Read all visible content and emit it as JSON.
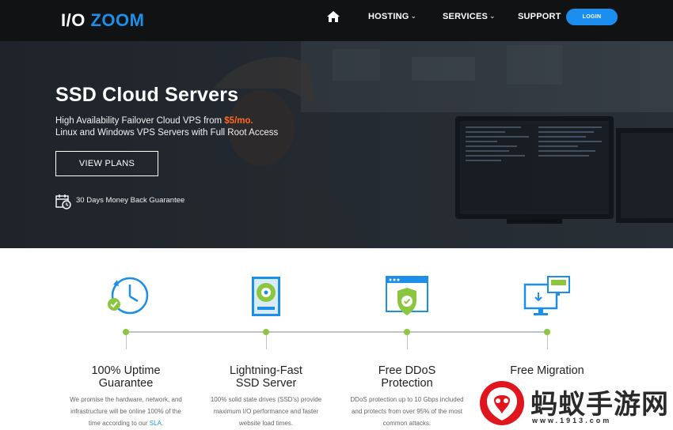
{
  "nav": {
    "logo_part1": "I/O",
    "logo_part2": "ZOOM",
    "home_icon": "home-icon",
    "hosting": "HOSTING",
    "services": "SERVICES",
    "support": "SUPPORT",
    "login": "LOGIN",
    "chevron": "⌄"
  },
  "hero": {
    "title": "SSD Cloud Servers",
    "line1_prefix": "High Availability Failover Cloud VPS from ",
    "price": "$5/mo.",
    "line2": "Linux and Windows VPS Servers with Full Root Access",
    "button": "VIEW PLANS",
    "guarantee": "30 Days Money Back Guarantee",
    "guarantee_icon": "calendar-clock-icon"
  },
  "features": [
    {
      "icon": "uptime-clock-icon",
      "title1": "100% Uptime",
      "title2": "Guarantee",
      "desc1": "We promise the hardware, network, and",
      "desc2": "infrastructure will be online 100% of the",
      "desc3_prefix": "time according to our ",
      "desc3_link": "SLA",
      "desc3_suffix": "."
    },
    {
      "icon": "ssd-drive-icon",
      "title1": "Lightning-Fast",
      "title2": "SSD Server",
      "desc1": "100% solid state drives (SSD's) provide",
      "desc2": "maximum I/O performance and faster",
      "desc3": "website load times."
    },
    {
      "icon": "shield-window-icon",
      "title1": "Free DDoS",
      "title2": "Protection",
      "desc1": "DDoS protection up to 10 Gbps included",
      "desc2": "and protects from over 95% of the most",
      "desc3": "common attacks."
    },
    {
      "icon": "migration-monitors-icon",
      "title1": "Free Migration"
    }
  ],
  "watermark": {
    "text": "蚂蚁手游网",
    "url": "www.1913.com"
  },
  "colors": {
    "brand_blue": "#1e8fe8",
    "accent_orange": "#ff6a1f",
    "green": "#8cc63f",
    "nav_bg": "#101214"
  }
}
